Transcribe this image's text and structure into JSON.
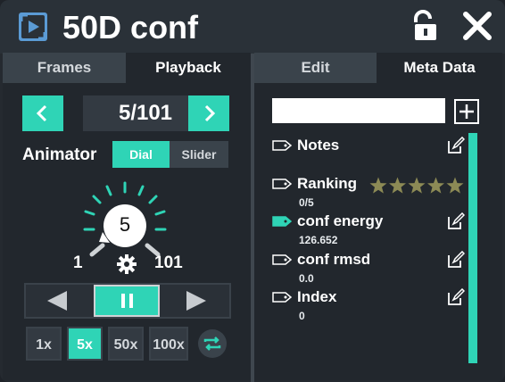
{
  "window": {
    "title": "50D conf"
  },
  "left_tabs": [
    "Frames",
    "Playback"
  ],
  "right_tabs": [
    "Edit",
    "Meta Data"
  ],
  "playback": {
    "frame_counter": "5/101",
    "animator_label": "Animator",
    "modes": [
      "Dial",
      "Slider"
    ],
    "dial_value": "5",
    "range_min": "1",
    "range_max": "101",
    "speeds": [
      "1x",
      "5x",
      "50x",
      "100x"
    ]
  },
  "meta": {
    "search_value": "",
    "items": [
      {
        "name": "Notes",
        "value": ""
      },
      {
        "name": "Ranking",
        "value": "0/5"
      },
      {
        "name": "conf energy",
        "value": "126.652"
      },
      {
        "name": "conf rmsd",
        "value": "0.0"
      },
      {
        "name": "Index",
        "value": "0"
      }
    ],
    "rating": 0,
    "rating_max": 5
  },
  "colors": {
    "accent": "#2fd4b6",
    "star": "#8c8a55"
  },
  "icons": {
    "app": "playback-app-icon",
    "lock": "unlock-icon",
    "close": "close-icon",
    "tag": "tag-icon",
    "edit": "edit-icon",
    "settings": "gear-icon",
    "loop": "loop-icon"
  }
}
